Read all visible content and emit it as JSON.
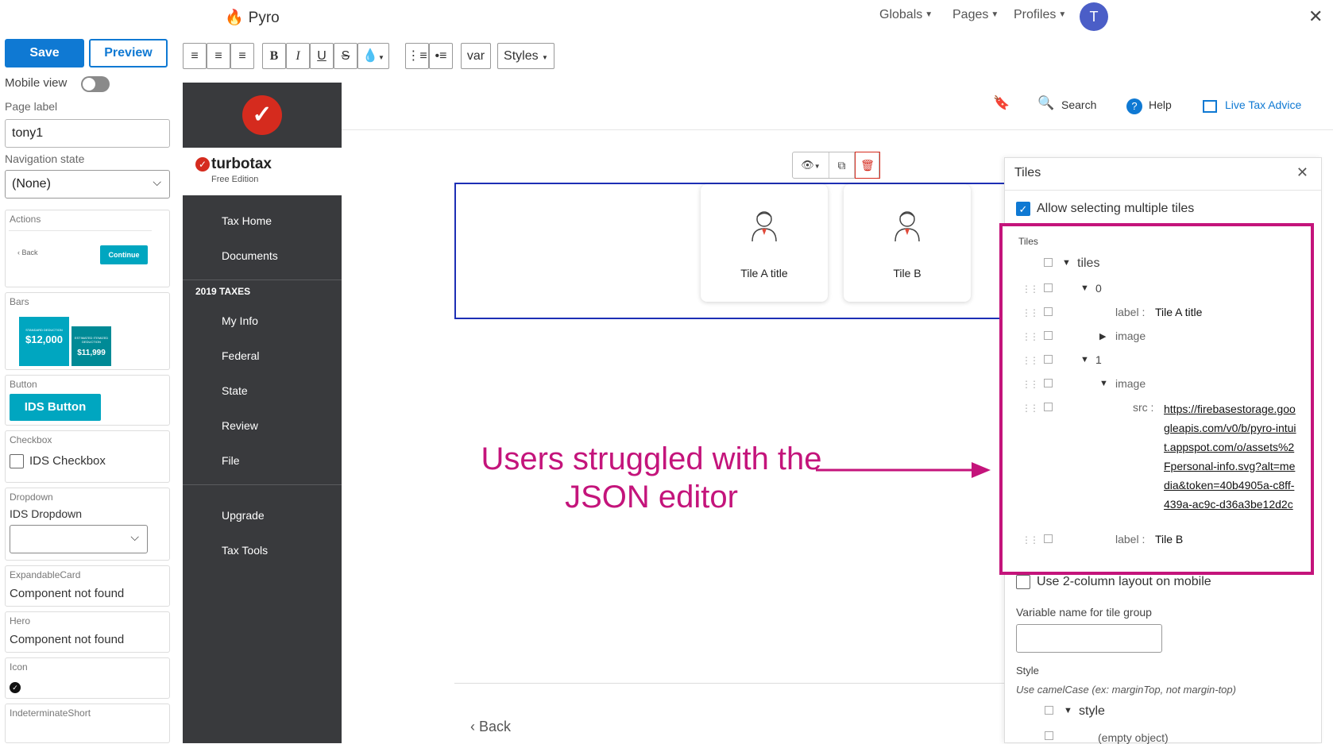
{
  "app": {
    "name": "Pyro",
    "avatar_letter": "T"
  },
  "topnav": {
    "globals": "Globals",
    "pages": "Pages",
    "profiles": "Profiles"
  },
  "leftpanel": {
    "save": "Save",
    "preview": "Preview",
    "mobile_view": "Mobile view",
    "page_label_title": "Page label",
    "page_label_value": "tony1",
    "nav_state_title": "Navigation state",
    "nav_state_value": "(None)",
    "cards": {
      "actions": {
        "label": "Actions",
        "back": "Back",
        "continue": "Continue"
      },
      "bars": {
        "label": "Bars",
        "amount1": "$12,000",
        "caption1": "STANDARD DEDUCTION",
        "amount2": "$11,999",
        "caption2": "ESTIMATED ITEMIZED DEDUCTION"
      },
      "button": {
        "label": "Button",
        "value": "IDS Button"
      },
      "checkbox": {
        "label": "Checkbox",
        "value": "IDS Checkbox"
      },
      "dropdown": {
        "label": "Dropdown",
        "value": "IDS Dropdown"
      },
      "expandable": {
        "label": "ExpandableCard",
        "value": "Component not found"
      },
      "hero": {
        "label": "Hero",
        "value": "Component not found"
      },
      "icon": {
        "label": "Icon"
      },
      "indeterminate": {
        "label": "IndeterminateShort"
      }
    }
  },
  "toolbar": {
    "var": "var",
    "styles": "Styles"
  },
  "turbotax": {
    "brand": "turbotax",
    "edition": "Free Edition",
    "items_top": [
      "Tax Home",
      "Documents"
    ],
    "section": "2019 TAXES",
    "items_mid": [
      "My Info",
      "Federal",
      "State",
      "Review",
      "File"
    ],
    "items_bottom": [
      "Upgrade",
      "Tax Tools"
    ]
  },
  "header_links": {
    "search": "Search",
    "help": "Help",
    "live": "Live Tax Advice"
  },
  "tiles": [
    {
      "title": "Tile A title"
    },
    {
      "title": "Tile B"
    }
  ],
  "annotation": "Users struggled with the JSON editor",
  "back": "Back",
  "rightpanel": {
    "title": "Tiles",
    "allow_multiple": "Allow selecting multiple tiles",
    "tree_label": "Tiles",
    "tree": {
      "root": "tiles",
      "idx0": "0",
      "label_key": "label :",
      "label0": "Tile A title",
      "image": "image",
      "idx1": "1",
      "src_key": "src :",
      "src": "https://firebasestorage.googleapis.com/v0/b/pyro-intuit.appspot.com/o/assets%2Fpersonal-info.svg?alt=media&token=40b4905a-c8ff-439a-ac9c-d36a3be12d2c",
      "label1": "Tile B"
    },
    "two_col": "Use 2-column layout on mobile",
    "varname_label": "Variable name for tile group",
    "style_label": "Style",
    "style_hint": "Use camelCase (ex: marginTop, not margin-top)",
    "style_root": "style",
    "empty": "(empty object)"
  },
  "colors": {
    "accent": "#0f79d3",
    "annotation": "#c4147b",
    "ttred": "#d52b1e",
    "sidebar": "#393a3d",
    "teal": "#00a6c0"
  }
}
